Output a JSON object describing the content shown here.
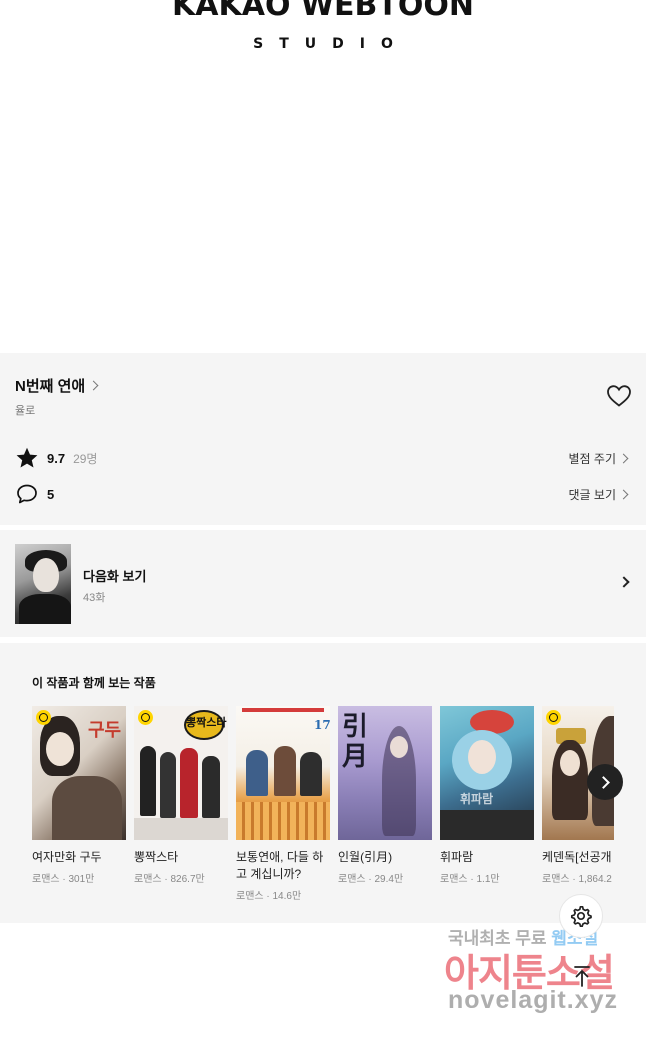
{
  "banner": {
    "logo_main": "KAKAO WEBTOON",
    "logo_sub": "STUDIO"
  },
  "work": {
    "title": "N번째 연애",
    "author": "율로",
    "rating": "9.7",
    "rating_count": "29명",
    "rate_action": "별점 주기",
    "comments": "5",
    "comments_action": "댓글 보기"
  },
  "next_episode": {
    "label": "다음화 보기",
    "episode": "43화"
  },
  "recommendations": {
    "heading": "이 작품과 함께 보는 작품",
    "items": [
      {
        "title": "여자만화 구두",
        "meta": "로맨스 · 301만",
        "cover_text": "구두",
        "wait_free": true
      },
      {
        "title": "뽕짝스타",
        "meta": "로맨스 · 826.7만",
        "cover_text": "뽕짝스타",
        "wait_free": true
      },
      {
        "title": "보통연애, 다들 하고 계십니까?",
        "meta": "로맨스 · 14.6만",
        "cover_text": "17",
        "wait_free": false
      },
      {
        "title": "인월(引月)",
        "meta": "로맨스 · 29.4만",
        "cover_text": "引月",
        "wait_free": false
      },
      {
        "title": "휘파람",
        "meta": "로맨스 · 1.1만",
        "cover_text": "휘파람",
        "wait_free": false
      },
      {
        "title": "케덴독[선공개",
        "meta": "로맨스 · 1,864.2",
        "cover_text": "",
        "wait_free": true
      }
    ]
  },
  "watermark": {
    "line1_a": "국내최초 무료 ",
    "line1_b": "웹소설",
    "line2": "아지툰소설",
    "line3": "novelagit.xyz"
  },
  "icons": {
    "heart": "heart-outline-icon",
    "star": "star-icon",
    "comment": "comment-bubble-icon",
    "settings": "gear-icon",
    "scroll_top": "arrow-up-icon"
  }
}
